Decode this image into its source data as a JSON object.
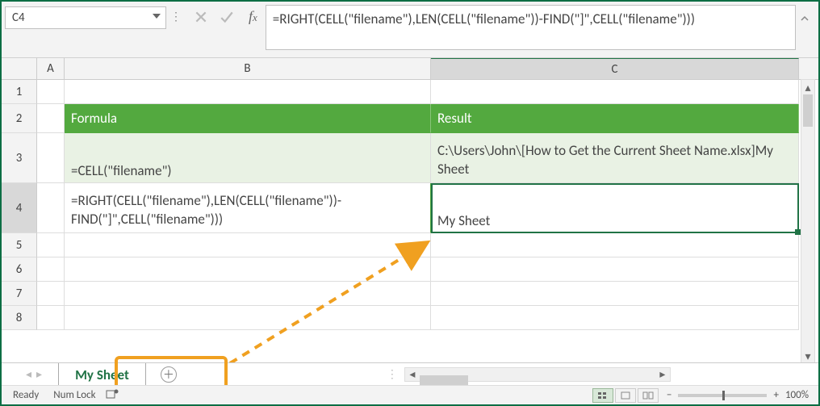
{
  "nameBox": "C4",
  "formula": "=RIGHT(CELL(\"filename\"),LEN(CELL(\"filename\"))-FIND(\"]\",CELL(\"filename\")))",
  "columns": {
    "A": "A",
    "B": "B",
    "C": "C"
  },
  "rows": [
    "1",
    "2",
    "3",
    "4",
    "5",
    "6",
    "7",
    "8"
  ],
  "headers": {
    "formula": "Formula",
    "result": "Result"
  },
  "cells": {
    "B3": "=CELL(\"filename\")",
    "C3": "C:\\Users\\John\\[How to Get the Current Sheet Name.xlsx]My Sheet",
    "B4": "=RIGHT(CELL(\"filename\"),LEN(CELL(\"filename\"))-FIND(\"]\",CELL(\"filename\")))",
    "C4": "My Sheet"
  },
  "sheetTab": "My Sheet",
  "status": {
    "ready": "Ready",
    "numlock": "Num Lock"
  },
  "zoom": "100%",
  "activeCell": "C4"
}
